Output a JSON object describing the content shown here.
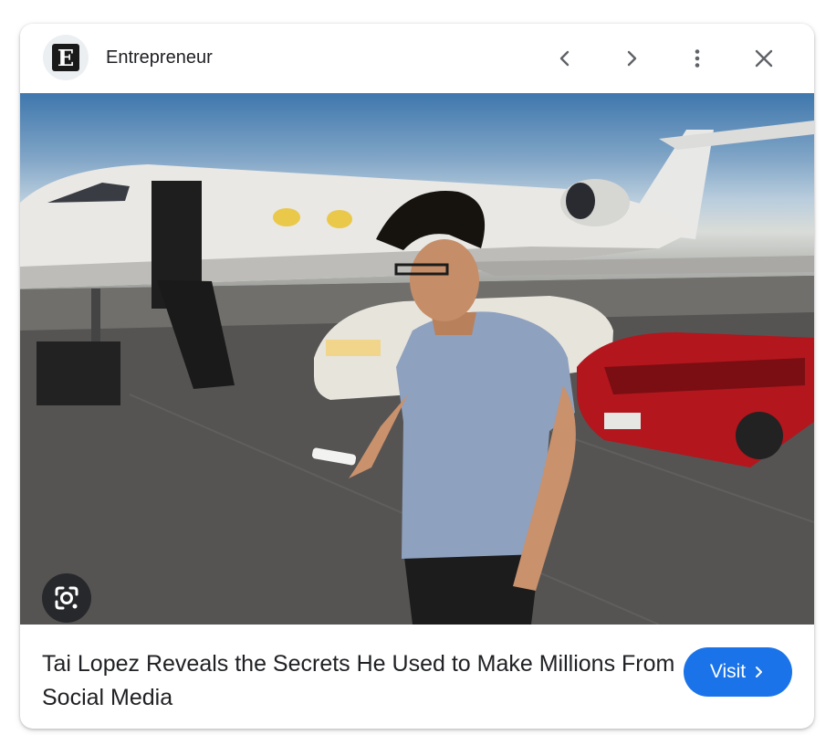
{
  "header": {
    "source_name": "Entrepreneur",
    "logo_letter": "E",
    "icons": [
      "chevron-left-icon",
      "chevron-right-icon",
      "more-vert-icon",
      "close-icon"
    ]
  },
  "image": {
    "lens_icon": "google-lens-icon"
  },
  "caption": {
    "title": "Tai Lopez Reveals the Secrets He Used to Make Millions From Social Media"
  },
  "actions": {
    "visit_label": "Visit",
    "visit_icon": "chevron-right-icon"
  },
  "colors": {
    "accent": "#1a73e8",
    "text": "#202124",
    "icon": "#5f6368"
  }
}
